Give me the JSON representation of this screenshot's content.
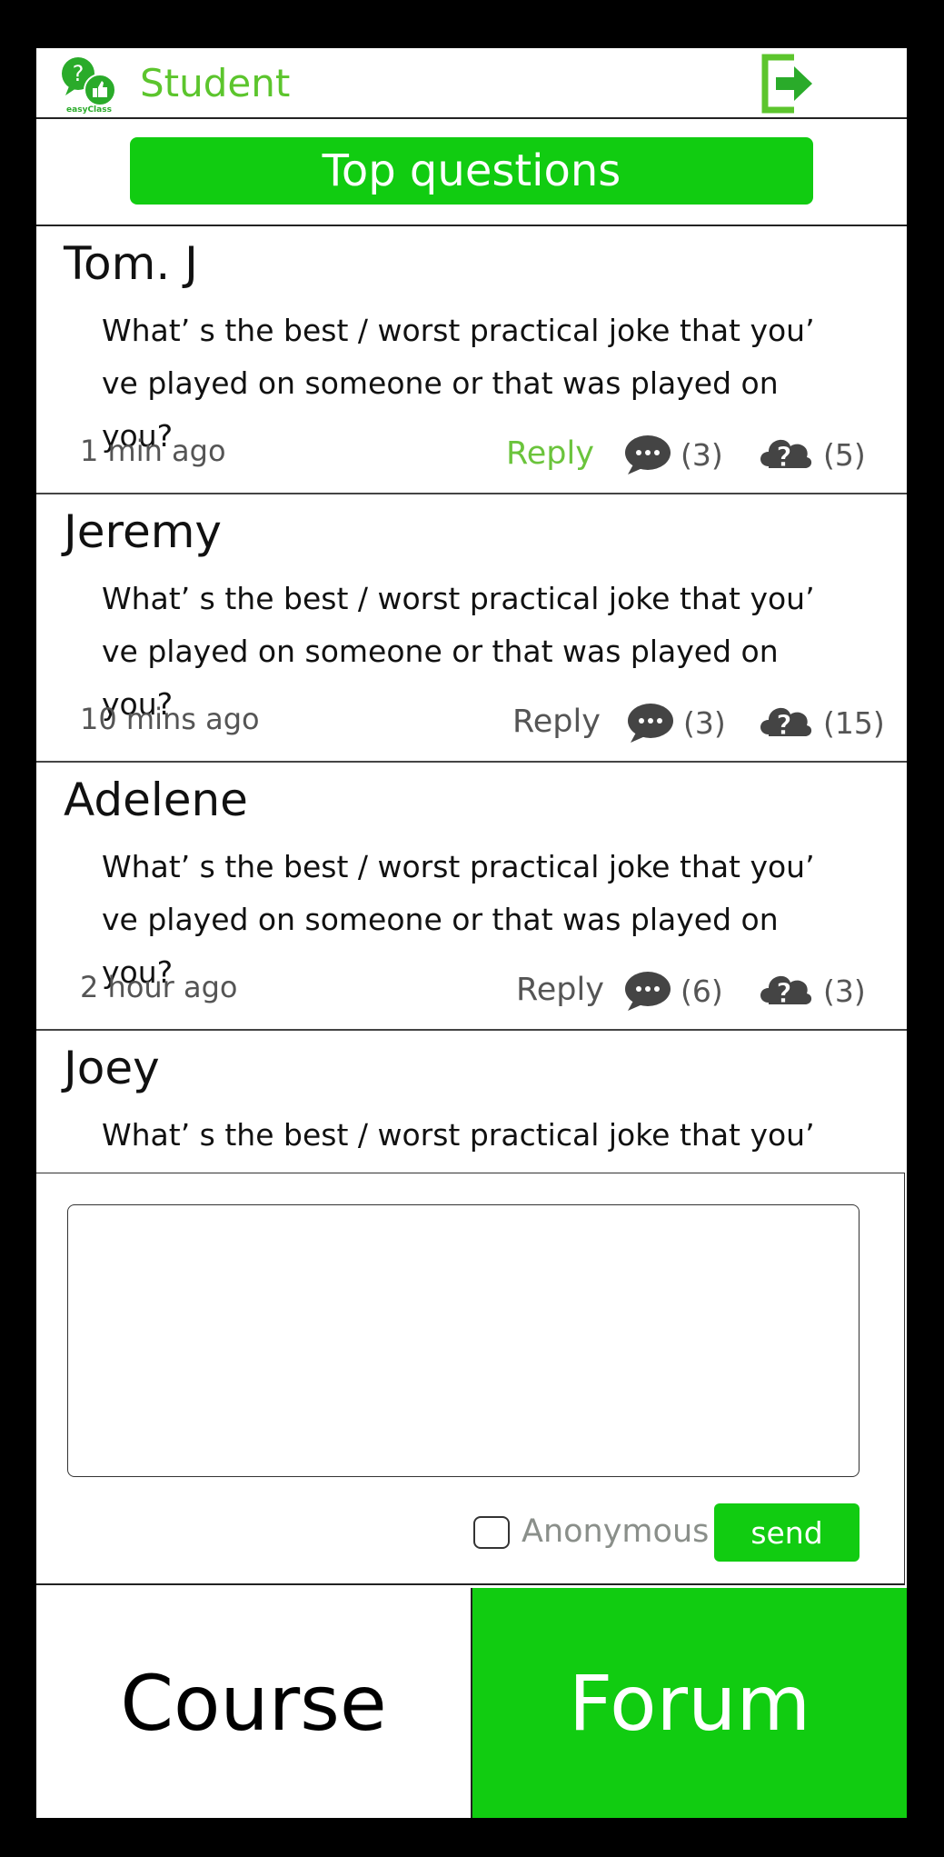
{
  "header": {
    "role_label": "Student",
    "logo_text": "easyClass",
    "logout_icon": "exit-icon",
    "accent_color": "#5cc52d"
  },
  "top_questions": {
    "label": "Top questions",
    "color": "#11cc11"
  },
  "questions": [
    {
      "author": "Tom. J",
      "body": "What’ s the best / worst practical joke that you’ ve played on someone or that was played on you?",
      "time": "1 min ago",
      "reply": "Reply",
      "comments": "(3)",
      "asks": "(5)"
    },
    {
      "author": "Jeremy",
      "body": "What’ s the best / worst practical joke that you’ ve played on someone or that was played on you?",
      "time": "10 mins ago",
      "reply": "Reply",
      "comments": "(3)",
      "asks": "(15)"
    },
    {
      "author": "Adelene",
      "body": "What’ s the best / worst practical joke that you’ ve played on someone or that was played on you?",
      "time": "2 hour ago",
      "reply": "Reply",
      "comments": "(6)",
      "asks": "(3)"
    },
    {
      "author": "Joey",
      "body": "What’ s the best / worst practical joke that you’ ve played on someone or that was played on you?",
      "time": "",
      "reply": "",
      "comments": "",
      "asks": ""
    }
  ],
  "compose": {
    "input_value": "",
    "anonymous_label": "Anonymous",
    "anonymous_checked": false,
    "send_label": "send"
  },
  "nav": {
    "course_label": "Course",
    "forum_label": "Forum",
    "active": "Forum"
  },
  "icons": {
    "comment": "speech-bubble-icon",
    "ask": "cloud-question-icon"
  }
}
